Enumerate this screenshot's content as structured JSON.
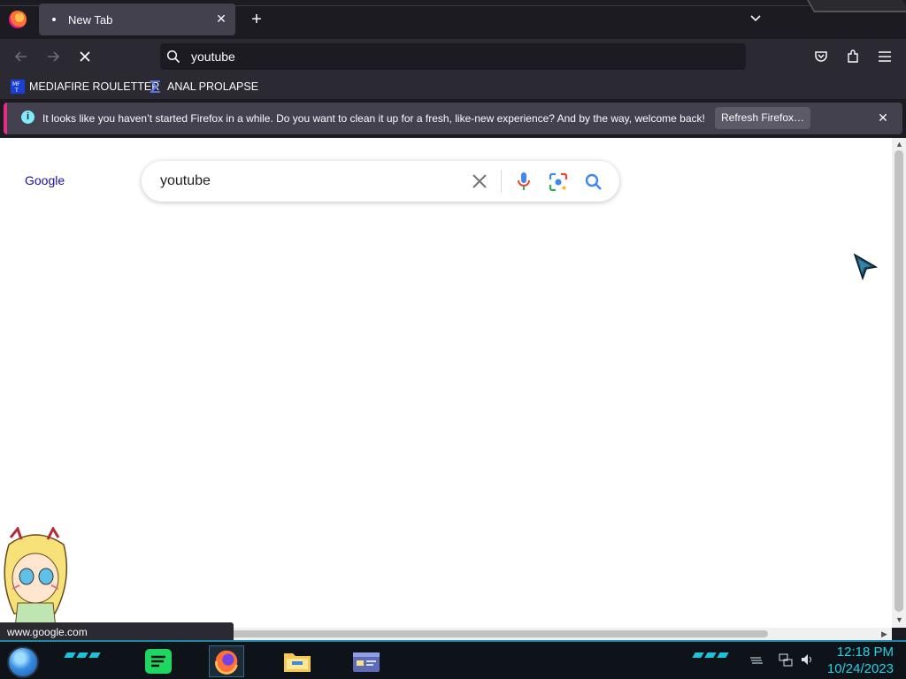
{
  "tabs": [
    {
      "title": "New Tab"
    }
  ],
  "urlbar": {
    "value": "youtube"
  },
  "bookmarks": [
    {
      "label": "MEDIAFIRE ROULETTER",
      "icon": "mediafire-icon"
    },
    {
      "label": "ANAL PROLAPSE",
      "icon": "sigma-icon"
    }
  ],
  "notification": {
    "message": "It looks like you haven’t started Firefox in a while. Do you want to clean it up for a fresh, like-new experience? And by the way, welcome back!",
    "button": "Refresh Firefox…"
  },
  "page": {
    "logo_text": "Google",
    "search_query": "youtube"
  },
  "status_text": "www.google.com",
  "taskbar": {
    "time": "12:18 PM",
    "date": "10/24/2023",
    "apps": [
      "spotify-icon",
      "firefox-icon",
      "file-explorer-icon",
      "card-app-icon"
    ]
  },
  "colors": {
    "accent": "#1fc1d9",
    "browser_bg": "#1c1b22",
    "toolbar_bg": "#2b2a33",
    "notif_stripe": "#e62e86"
  }
}
